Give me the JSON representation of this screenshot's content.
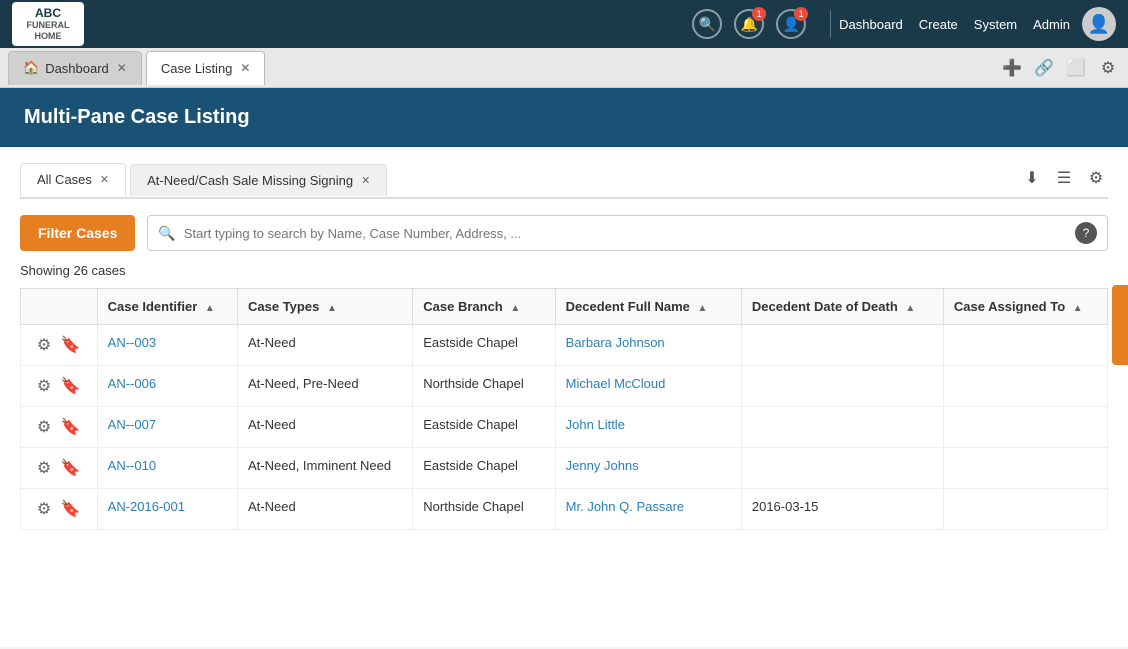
{
  "topNav": {
    "logoLine1": "ABC",
    "logoLine2": "FUNERAL HOME",
    "icons": [
      {
        "name": "search-icon",
        "symbol": "🔍",
        "badge": null
      },
      {
        "name": "bell-icon",
        "symbol": "🔔",
        "badge": "1"
      },
      {
        "name": "user-icon",
        "symbol": "👤",
        "badge": "1"
      }
    ],
    "links": [
      "Dashboard",
      "Create",
      "System",
      "Admin"
    ]
  },
  "tabsBar": {
    "tabs": [
      {
        "label": "Dashboard",
        "active": false,
        "closable": true,
        "icon": "🏠"
      },
      {
        "label": "Case Listing",
        "active": true,
        "closable": true
      }
    ],
    "actions": [
      "➕",
      "🔗",
      "⬜",
      "⚙"
    ]
  },
  "pageHeader": {
    "title": "Multi-Pane Case Listing"
  },
  "innerTabs": {
    "tabs": [
      {
        "label": "All Cases",
        "active": true,
        "closable": true
      },
      {
        "label": "At-Need/Cash Sale Missing Signing",
        "active": false,
        "closable": true
      }
    ],
    "actions": [
      "⬇",
      "☰",
      "⚙"
    ]
  },
  "filterBar": {
    "filterButton": "Filter Cases",
    "searchPlaceholder": "Start typing to search by Name, Case Number, Address, ...",
    "helpIcon": "?"
  },
  "showingCount": "Showing 26 cases",
  "table": {
    "columns": [
      {
        "key": "actions",
        "label": ""
      },
      {
        "key": "identifier",
        "label": "Case Identifier",
        "sortable": true
      },
      {
        "key": "types",
        "label": "Case Types",
        "sortable": true
      },
      {
        "key": "branch",
        "label": "Case Branch",
        "sortable": true
      },
      {
        "key": "decedent",
        "label": "Decedent Full Name",
        "sortable": true
      },
      {
        "key": "dod",
        "label": "Decedent Date of Death",
        "sortable": true
      },
      {
        "key": "assigned",
        "label": "Case Assigned To",
        "sortable": true
      }
    ],
    "rows": [
      {
        "identifier": "AN--003",
        "types": "At-Need",
        "branch": "Eastside Chapel",
        "decedent": "Barbara Johnson",
        "dod": "",
        "assigned": ""
      },
      {
        "identifier": "AN--006",
        "types": "At-Need, Pre-Need",
        "branch": "Northside Chapel",
        "decedent": "Michael McCloud",
        "dod": "",
        "assigned": ""
      },
      {
        "identifier": "AN--007",
        "types": "At-Need",
        "branch": "Eastside Chapel",
        "decedent": "John Little",
        "dod": "",
        "assigned": ""
      },
      {
        "identifier": "AN--010",
        "types": "At-Need, Imminent Need",
        "branch": "Eastside Chapel",
        "decedent": "Jenny Johns",
        "dod": "",
        "assigned": ""
      },
      {
        "identifier": "AN-2016-001",
        "types": "At-Need",
        "branch": "Northside Chapel",
        "decedent": "Mr. John Q. Passare",
        "dod": "2016-03-15",
        "assigned": ""
      }
    ]
  }
}
